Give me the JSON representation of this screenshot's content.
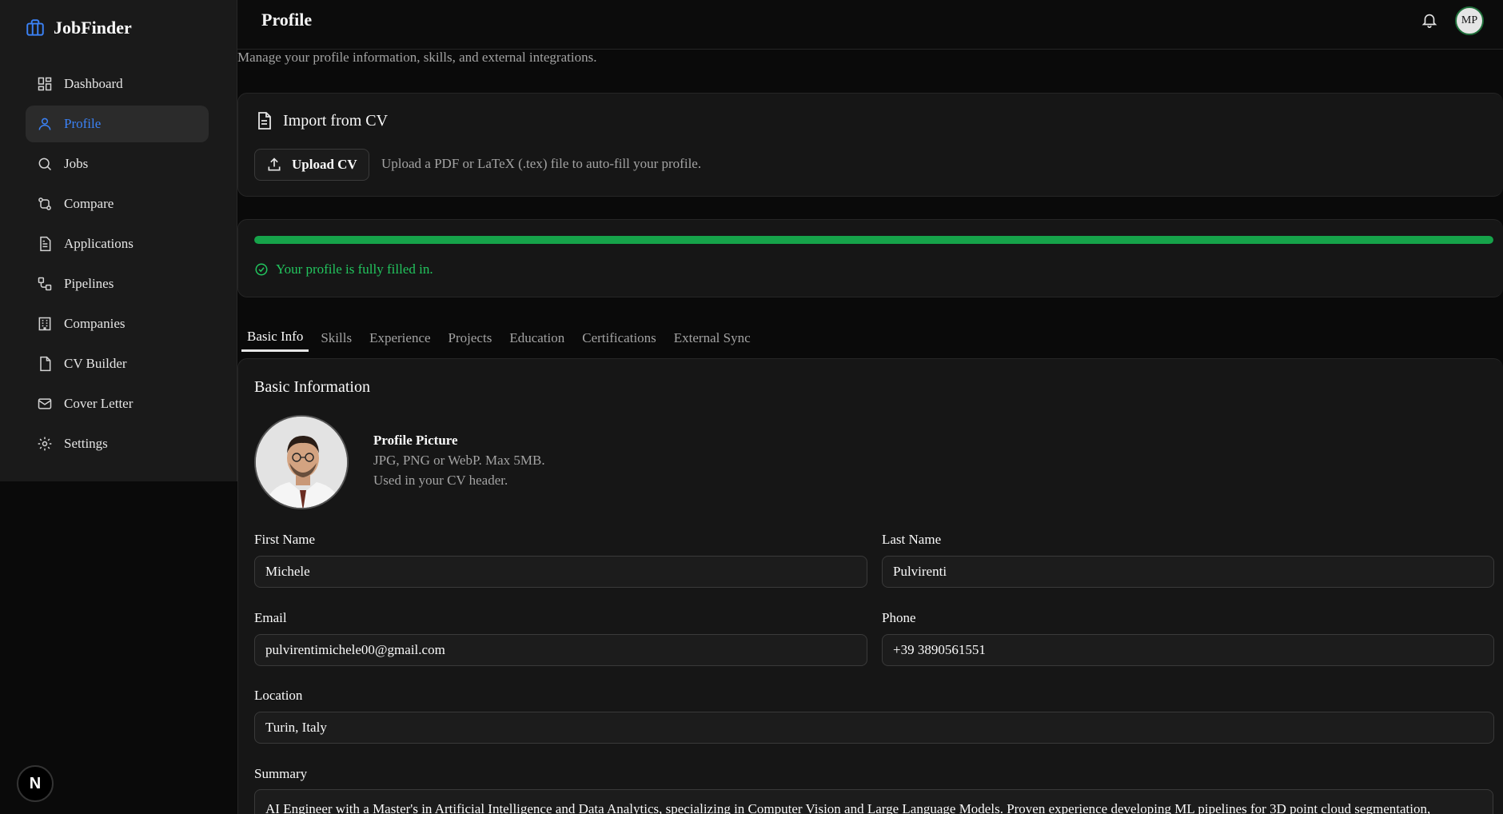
{
  "app": {
    "name": "JobFinder"
  },
  "sidebar": {
    "items": [
      {
        "label": "Dashboard",
        "icon": "dashboard-icon"
      },
      {
        "label": "Profile",
        "icon": "user-icon",
        "active": true
      },
      {
        "label": "Jobs",
        "icon": "search-icon"
      },
      {
        "label": "Compare",
        "icon": "compare-icon"
      },
      {
        "label": "Applications",
        "icon": "document-icon"
      },
      {
        "label": "Pipelines",
        "icon": "pipeline-icon"
      },
      {
        "label": "Companies",
        "icon": "building-icon"
      },
      {
        "label": "CV Builder",
        "icon": "file-icon"
      },
      {
        "label": "Cover Letter",
        "icon": "mail-icon"
      },
      {
        "label": "Settings",
        "icon": "gear-icon"
      }
    ],
    "badge": "N"
  },
  "header": {
    "title": "Profile",
    "avatar_initials": "MP"
  },
  "subtitle": "Manage your profile information, skills, and external integrations.",
  "import": {
    "title": "Import from CV",
    "upload_label": "Upload CV",
    "hint": "Upload a PDF or LaTeX (.tex) file to auto-fill your profile."
  },
  "progress": {
    "percent": 100,
    "message": "Your profile is fully filled in."
  },
  "tabs": [
    "Basic Info",
    "Skills",
    "Experience",
    "Projects",
    "Education",
    "Certifications",
    "External Sync"
  ],
  "basic": {
    "title": "Basic Information",
    "picture_label": "Profile Picture",
    "picture_hint1": "JPG, PNG or WebP. Max 5MB.",
    "picture_hint2": "Used in your CV header.",
    "first_name_label": "First Name",
    "first_name": "Michele",
    "last_name_label": "Last Name",
    "last_name": "Pulvirenti",
    "email_label": "Email",
    "email": "pulvirentimichele00@gmail.com",
    "phone_label": "Phone",
    "phone": "+39 3890561551",
    "location_label": "Location",
    "location": "Turin, Italy",
    "summary_label": "Summary",
    "summary": "AI Engineer with a Master's in Artificial Intelligence and Data Analytics, specializing in Computer Vision and Large Language Models. Proven experience developing ML pipelines for 3D point cloud segmentation,"
  },
  "colors": {
    "accent": "#3b82f6",
    "success": "#22c55e",
    "progress": "#16a34a"
  }
}
